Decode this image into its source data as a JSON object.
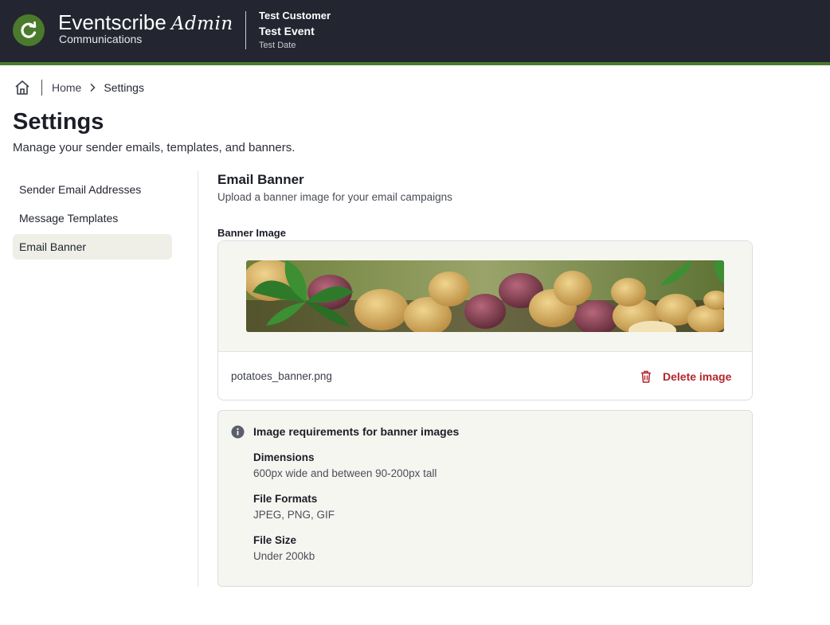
{
  "header": {
    "brand_name": "Eventscribe",
    "brand_admin": "Admin",
    "brand_sub": "Communications",
    "customer": "Test Customer",
    "event": "Test Event",
    "date": "Test Date"
  },
  "breadcrumb": {
    "home_icon": "home-icon",
    "home_label": "Home",
    "current": "Settings"
  },
  "page": {
    "title": "Settings",
    "subtitle": "Manage your sender emails, templates, and banners."
  },
  "sidebar": {
    "items": [
      {
        "label": "Sender Email Addresses",
        "active": false
      },
      {
        "label": "Message Templates",
        "active": false
      },
      {
        "label": "Email Banner",
        "active": true
      }
    ]
  },
  "main": {
    "title": "Email Banner",
    "description": "Upload a banner image for your email campaigns",
    "field_label": "Banner Image",
    "file_name": "potatoes_banner.png",
    "delete_label": "Delete image",
    "requirements": {
      "title": "Image requirements for banner images",
      "items": [
        {
          "heading": "Dimensions",
          "value": "600px wide and between 90-200px tall"
        },
        {
          "heading": "File Formats",
          "value": "JPEG, PNG, GIF"
        },
        {
          "heading": "File Size",
          "value": "Under 200kb"
        }
      ]
    }
  },
  "colors": {
    "header_bg": "#232530",
    "accent_green": "#4a7a2c",
    "danger": "#b3262b",
    "active_nav_bg": "#efefe8"
  }
}
